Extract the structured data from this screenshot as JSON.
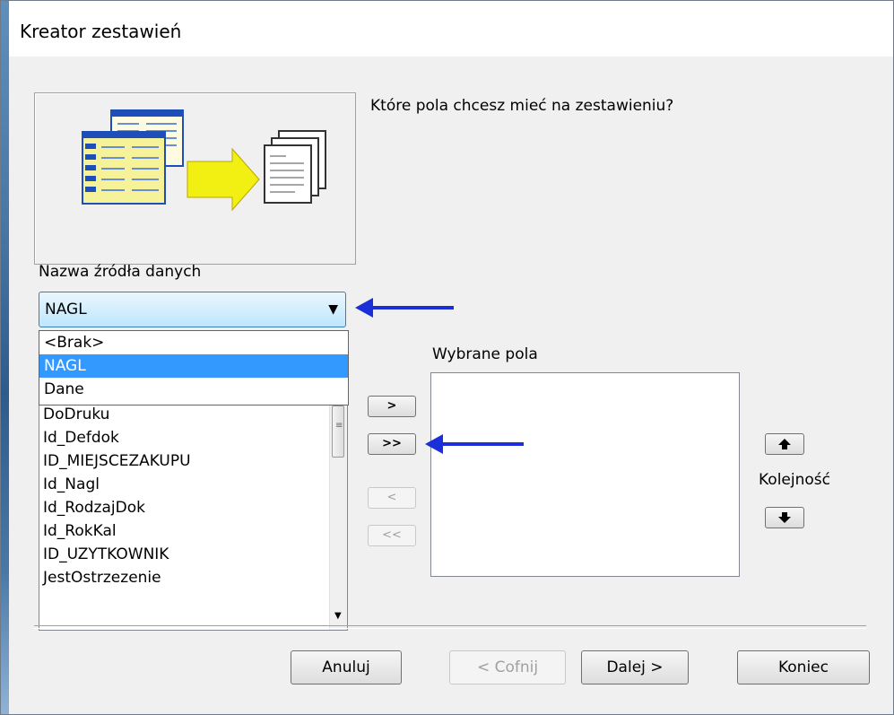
{
  "window": {
    "title": "Kreator zestawień"
  },
  "question": "Które pola chcesz mieć na zestawieniu?",
  "source": {
    "label": "Nazwa źródła danych",
    "selected": "NAGL",
    "options": [
      "<Brak>",
      "NAGL",
      "Dane"
    ]
  },
  "available_fields": [
    "DoDruku",
    "Id_Defdok",
    "ID_MIEJSCEZAKUPU",
    "Id_Nagl",
    "Id_RodzajDok",
    "Id_RokKal",
    "ID_UZYTKOWNIK",
    "JestOstrzezenie"
  ],
  "selected_fields": {
    "label": "Wybrane pola",
    "items": []
  },
  "move_buttons": {
    "add_one": ">",
    "add_all": ">>",
    "remove_one": "<",
    "remove_all": "<<"
  },
  "order": {
    "label": "Kolejność",
    "up_icon": "arrow-up-icon",
    "down_icon": "arrow-down-icon"
  },
  "footer": {
    "cancel": "Anuluj",
    "back": "< Cofnij",
    "next": "Dalej >",
    "finish": "Koniec"
  },
  "annotation_color": "#1a2fd8"
}
